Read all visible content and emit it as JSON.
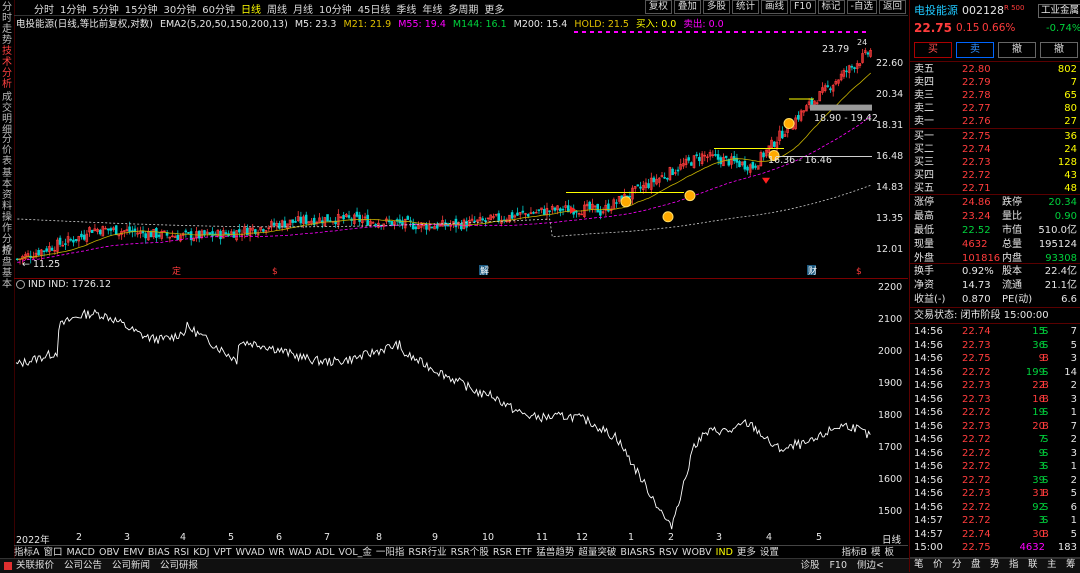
{
  "left_tabs": [
    "分时走势",
    "技术分析",
    "成交明细",
    "分价表",
    "基本资料",
    "操作分析",
    "控盘基本"
  ],
  "toolbar": {
    "periods": [
      "分时",
      "1分钟",
      "5分钟",
      "15分钟",
      "30分钟",
      "60分钟",
      "日线",
      "周线",
      "月线",
      "10分钟",
      "45日线",
      "季线",
      "年线",
      "多周期",
      "更多"
    ],
    "selected_period": "日线",
    "tools": [
      "复权",
      "叠加",
      "多股",
      "统计",
      "画线",
      "F10",
      "标记",
      "-自选",
      "返回"
    ]
  },
  "main_legend": {
    "title": "电投能源(日线,等比前复权,对数)",
    "ema": "EMA2(5,20,50,150,200,13)",
    "m5": "M5: 23.3",
    "m21": "M21: 21.9",
    "m55": "M55: 19.4",
    "m144": "M144: 16.1",
    "m200": "M200: 15.4",
    "hold": "HOLD: 21.5",
    "buy": "买入: 0.0",
    "sell": "卖出: 0.0"
  },
  "price_axis": [
    "22.60",
    "20.34",
    "18.31",
    "16.48",
    "14.83",
    "13.35",
    "12.01"
  ],
  "annotations": {
    "high_label": "23.79",
    "high_right": "24",
    "low_label": "11.25",
    "range1": "18.90 - 19.42",
    "range2": "16.36 - 16.46"
  },
  "event_markers": [
    "定",
    "$",
    "解",
    "财",
    "$"
  ],
  "ind_legend": {
    "name": "IND",
    "value": "IND: 1726.12"
  },
  "ind_axis": [
    "2200",
    "2100",
    "2000",
    "1900",
    "1800",
    "1700",
    "1600",
    "1500"
  ],
  "time_axis": [
    "2022年",
    "2",
    "3",
    "4",
    "5",
    "6",
    "7",
    "8",
    "9",
    "10",
    "11",
    "12",
    "1",
    "2",
    "3",
    "4",
    "5"
  ],
  "time_axis_right": "日线",
  "indicator_tabs": [
    "指标A",
    "窗口",
    "MACD",
    "OBV",
    "EMV",
    "BIAS",
    "RSI",
    "KDJ",
    "VPT",
    "WVAD",
    "WR",
    "WAD",
    "ADL",
    "VOL_金",
    "一阳指",
    "RSR行业",
    "RSR个股",
    "RSR ETF",
    "猛兽趋势",
    "超量突破",
    "BIASRS",
    "RSV",
    "WOBV",
    "IND",
    "更多",
    "设置"
  ],
  "selected_indicator": "IND",
  "indicator_right": [
    "指标B",
    "模",
    "板"
  ],
  "statusbar": {
    "items": [
      "关联报价",
      "公司公告",
      "公司新闻",
      "公司研报"
    ],
    "right": [
      "诊股",
      "F10",
      "侧边<"
    ]
  },
  "quote": {
    "name": "电投能源",
    "code": "002128",
    "tag": "R 500",
    "industry": "工业金属",
    "industry_change": "-0.74%",
    "price": "22.75",
    "change": "0.15",
    "change_pct": "0.66%",
    "buttons": [
      "买",
      "卖",
      "撤",
      "撤"
    ],
    "asks": [
      {
        "label": "卖五",
        "price": "22.80",
        "vol": "802"
      },
      {
        "label": "卖四",
        "price": "22.79",
        "vol": "7"
      },
      {
        "label": "卖三",
        "price": "22.78",
        "vol": "65"
      },
      {
        "label": "卖二",
        "price": "22.77",
        "vol": "80"
      },
      {
        "label": "卖一",
        "price": "22.76",
        "vol": "27"
      }
    ],
    "bids": [
      {
        "label": "买一",
        "price": "22.75",
        "vol": "36"
      },
      {
        "label": "买二",
        "price": "22.74",
        "vol": "24"
      },
      {
        "label": "买三",
        "price": "22.73",
        "vol": "128"
      },
      {
        "label": "买四",
        "price": "22.72",
        "vol": "43"
      },
      {
        "label": "买五",
        "price": "22.71",
        "vol": "48"
      }
    ],
    "stats": [
      {
        "l1": "涨停",
        "v1": "24.86",
        "l2": "跌停",
        "v2": "20.34"
      },
      {
        "l1": "最高",
        "v1": "23.24",
        "l2": "量比",
        "v2": "0.90"
      },
      {
        "l1": "最低",
        "v1": "22.52",
        "l2": "市值",
        "v2": "510.0亿"
      },
      {
        "l1": "现量",
        "v1": "4632",
        "l2": "总量",
        "v2": "195124"
      },
      {
        "l1": "外盘",
        "v1": "101816",
        "l2": "内盘",
        "v2": "93308"
      }
    ],
    "stats2": [
      {
        "l1": "换手",
        "v1": "0.92%",
        "l2": "股本",
        "v2": "22.4亿"
      },
      {
        "l1": "净资",
        "v1": "14.73",
        "l2": "流通",
        "v2": "21.1亿"
      },
      {
        "l1": "收益(-)",
        "v1": "0.870",
        "l2": "PE(动)",
        "v2": "6.6"
      }
    ],
    "trade_state": "交易状态: 闭市阶段 15:00:00",
    "ticks": [
      {
        "t": "14:56",
        "p": "22.74",
        "v": "15",
        "s": "S",
        "n": "7"
      },
      {
        "t": "14:56",
        "p": "22.73",
        "v": "36",
        "s": "S",
        "n": "5"
      },
      {
        "t": "14:56",
        "p": "22.75",
        "v": "9",
        "s": "B",
        "n": "3"
      },
      {
        "t": "14:56",
        "p": "22.72",
        "v": "199",
        "s": "S",
        "n": "14"
      },
      {
        "t": "14:56",
        "p": "22.73",
        "v": "22",
        "s": "B",
        "n": "2"
      },
      {
        "t": "14:56",
        "p": "22.73",
        "v": "16",
        "s": "B",
        "n": "3"
      },
      {
        "t": "14:56",
        "p": "22.72",
        "v": "19",
        "s": "S",
        "n": "1"
      },
      {
        "t": "14:56",
        "p": "22.73",
        "v": "20",
        "s": "B",
        "n": "7"
      },
      {
        "t": "14:56",
        "p": "22.72",
        "v": "7",
        "s": "S",
        "n": "2"
      },
      {
        "t": "14:56",
        "p": "22.72",
        "v": "9",
        "s": "S",
        "n": "3"
      },
      {
        "t": "14:56",
        "p": "22.72",
        "v": "3",
        "s": "S",
        "n": "1"
      },
      {
        "t": "14:56",
        "p": "22.72",
        "v": "39",
        "s": "S",
        "n": "2"
      },
      {
        "t": "14:56",
        "p": "22.73",
        "v": "31",
        "s": "B",
        "n": "5"
      },
      {
        "t": "14:56",
        "p": "22.72",
        "v": "92",
        "s": "S",
        "n": "6"
      },
      {
        "t": "14:57",
        "p": "22.72",
        "v": "3",
        "s": "S",
        "n": "1"
      },
      {
        "t": "14:57",
        "p": "22.74",
        "v": "30",
        "s": "B",
        "n": "5"
      },
      {
        "t": "15:00",
        "p": "22.75",
        "v": "4632",
        "s": "",
        "n": "183"
      }
    ],
    "bottom_tabs": [
      "笔",
      "价",
      "分",
      "盘",
      "势",
      "指",
      "联",
      "主",
      "筹"
    ]
  }
}
